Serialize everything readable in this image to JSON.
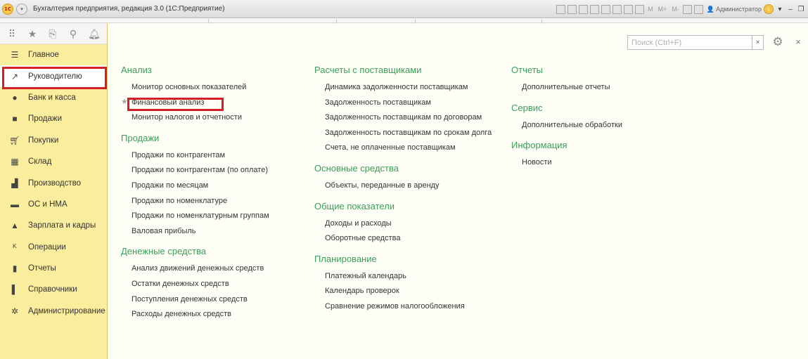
{
  "app": {
    "logo": "1С",
    "title": "Бухгалтерия предприятия, редакция 3.0  (1С:Предприятие)",
    "toolbar_labels": [
      "M",
      "M+",
      "M-"
    ],
    "user": "Администратор"
  },
  "sidebar": {
    "items": [
      {
        "label": "Главное",
        "icon": "menu-lines-icon"
      },
      {
        "label": "Руководителю",
        "icon": "trend-up-icon"
      },
      {
        "label": "Банк и касса",
        "icon": "coin-icon"
      },
      {
        "label": "Продажи",
        "icon": "shopping-bag-icon"
      },
      {
        "label": "Покупки",
        "icon": "cart-icon"
      },
      {
        "label": "Склад",
        "icon": "warehouse-icon"
      },
      {
        "label": "Производство",
        "icon": "factory-icon"
      },
      {
        "label": "ОС и НМА",
        "icon": "truck-icon"
      },
      {
        "label": "Зарплата и кадры",
        "icon": "person-icon"
      },
      {
        "label": "Операции",
        "icon": "dt-kt-icon"
      },
      {
        "label": "Отчеты",
        "icon": "bar-chart-icon"
      },
      {
        "label": "Справочники",
        "icon": "book-icon"
      },
      {
        "label": "Администрирование",
        "icon": "gear-icon"
      }
    ],
    "active_index": 1
  },
  "search": {
    "placeholder": "Поиск (Ctrl+F)",
    "clear": "×"
  },
  "columns": [
    {
      "groups": [
        {
          "title": "Анализ",
          "items": [
            "Монитор основных показателей",
            "Финансовый анализ",
            "Монитор налогов и отчетности"
          ]
        },
        {
          "title": "Продажи",
          "items": [
            "Продажи по контрагентам",
            "Продажи по контрагентам (по оплате)",
            "Продажи по месяцам",
            "Продажи по номенклатуре",
            "Продажи по номенклатурным группам",
            "Валовая прибыль"
          ]
        },
        {
          "title": "Денежные средства",
          "items": [
            "Анализ движений денежных средств",
            "Остатки денежных средств",
            "Поступления денежных средств",
            "Расходы денежных средств"
          ]
        }
      ]
    },
    {
      "groups": [
        {
          "title": "Расчеты с поставщиками",
          "items": [
            "Динамика задолженности поставщикам",
            "Задолженность поставщикам",
            "Задолженность поставщикам по договорам",
            "Задолженность поставщикам по срокам долга",
            "Счета, не оплаченные поставщикам"
          ]
        },
        {
          "title": "Основные средства",
          "items": [
            "Объекты, переданные в аренду"
          ]
        },
        {
          "title": "Общие показатели",
          "items": [
            "Доходы и расходы",
            "Оборотные средства"
          ]
        },
        {
          "title": "Планирование",
          "items": [
            "Платежный календарь",
            "Календарь проверок",
            "Сравнение режимов налогообложения"
          ]
        }
      ]
    },
    {
      "groups": [
        {
          "title": "Отчеты",
          "items": [
            "Дополнительные отчеты"
          ]
        },
        {
          "title": "Сервис",
          "items": [
            "Дополнительные обработки"
          ]
        },
        {
          "title": "Информация",
          "items": [
            "Новости"
          ]
        }
      ]
    }
  ],
  "colors": {
    "accent_green": "#3b9e57",
    "sidebar_bg": "#fbed9e",
    "highlight_red": "#d51f26"
  }
}
